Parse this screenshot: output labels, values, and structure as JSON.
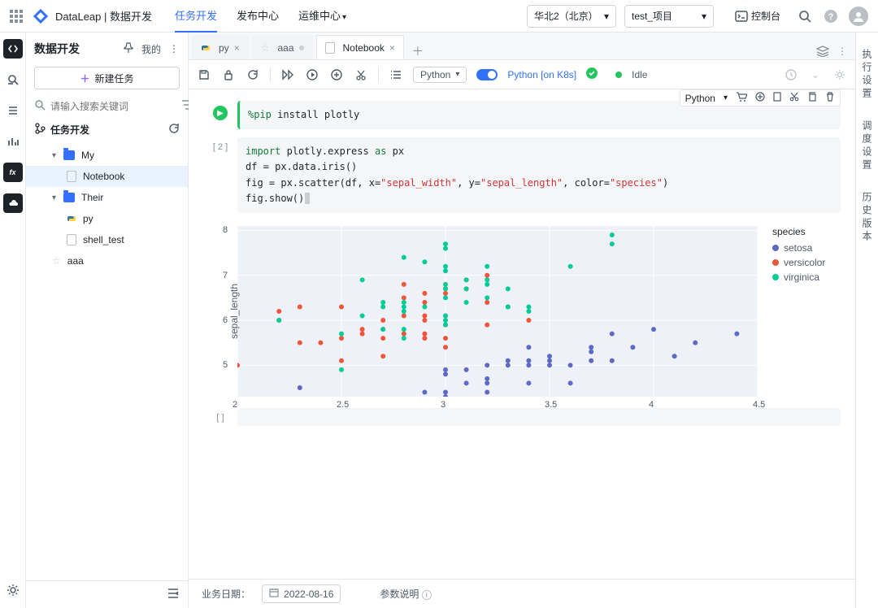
{
  "topbar": {
    "brand": "DataLeap | 数据开发",
    "nav": [
      "任务开发",
      "发布中心",
      "运维中心"
    ],
    "region": "华北2（北京）",
    "project": "test_项目",
    "console": "控制台"
  },
  "sidebar": {
    "title": "数据开发",
    "mine": "我的",
    "new_task": "新建任务",
    "search_placeholder": "请输入搜索关键词",
    "section": "任务开发",
    "tree": {
      "my": "My",
      "notebook": "Notebook",
      "their": "Their",
      "py": "py",
      "shell_test": "shell_test",
      "aaa": "aaa"
    }
  },
  "tabs": {
    "py": "py",
    "aaa": "aaa",
    "notebook": "Notebook"
  },
  "nb_toolbar": {
    "language": "Python",
    "kernel": "Python [on K8s]",
    "idle": "Idle"
  },
  "cell_toolbar": {
    "lang": "Python"
  },
  "cells": {
    "c1_prompt": "",
    "c1_code": "%pip install plotly",
    "c2_prompt": "[ 2 ]",
    "c2_code_plain": "import plotly.express as px\ndf = px.data.iris()\nfig = px.scatter(df, x=\"sepal_width\", y=\"sepal_length\", color=\"species\")\nfig.show()",
    "c3_prompt": "[  ]"
  },
  "chart_data": {
    "type": "scatter",
    "xlabel": "sepal_width",
    "ylabel": "sepal_length",
    "xlim": [
      2,
      4.5
    ],
    "ylim": [
      4.3,
      8.1
    ],
    "xticks": [
      2,
      2.5,
      3,
      3.5,
      4,
      4.5
    ],
    "yticks": [
      5,
      6,
      7,
      8
    ],
    "legend_title": "species",
    "colors": {
      "setosa": "#5c6ac4",
      "versicolor": "#ef553b",
      "virginica": "#00cc96"
    },
    "series": [
      {
        "name": "setosa",
        "points": [
          [
            2.3,
            4.5
          ],
          [
            2.9,
            4.4
          ],
          [
            3.0,
            4.4
          ],
          [
            3.0,
            4.3
          ],
          [
            3.0,
            4.8
          ],
          [
            3.0,
            4.9
          ],
          [
            3.1,
            4.6
          ],
          [
            3.1,
            4.9
          ],
          [
            3.2,
            4.4
          ],
          [
            3.2,
            4.6
          ],
          [
            3.2,
            4.7
          ],
          [
            3.2,
            5.0
          ],
          [
            3.3,
            5.1
          ],
          [
            3.3,
            5.0
          ],
          [
            3.4,
            4.6
          ],
          [
            3.4,
            5.0
          ],
          [
            3.4,
            5.1
          ],
          [
            3.4,
            5.4
          ],
          [
            3.5,
            5.1
          ],
          [
            3.5,
            5.0
          ],
          [
            3.5,
            5.2
          ],
          [
            3.6,
            4.6
          ],
          [
            3.6,
            5.0
          ],
          [
            3.7,
            5.1
          ],
          [
            3.7,
            5.3
          ],
          [
            3.7,
            5.4
          ],
          [
            3.8,
            5.1
          ],
          [
            3.8,
            5.7
          ],
          [
            3.9,
            5.4
          ],
          [
            4.0,
            5.8
          ],
          [
            4.1,
            5.2
          ],
          [
            4.2,
            5.5
          ],
          [
            4.4,
            5.7
          ]
        ]
      },
      {
        "name": "versicolor",
        "points": [
          [
            2.0,
            5.0
          ],
          [
            2.2,
            6.0
          ],
          [
            2.2,
            6.2
          ],
          [
            2.3,
            5.5
          ],
          [
            2.3,
            6.3
          ],
          [
            2.4,
            5.5
          ],
          [
            2.5,
            5.1
          ],
          [
            2.5,
            5.6
          ],
          [
            2.5,
            6.3
          ],
          [
            2.6,
            5.7
          ],
          [
            2.6,
            5.8
          ],
          [
            2.7,
            5.2
          ],
          [
            2.7,
            5.6
          ],
          [
            2.7,
            5.8
          ],
          [
            2.7,
            6.0
          ],
          [
            2.8,
            5.7
          ],
          [
            2.8,
            6.1
          ],
          [
            2.8,
            6.5
          ],
          [
            2.8,
            6.8
          ],
          [
            2.9,
            5.6
          ],
          [
            2.9,
            5.7
          ],
          [
            2.9,
            6.0
          ],
          [
            2.9,
            6.1
          ],
          [
            2.9,
            6.4
          ],
          [
            2.9,
            6.6
          ],
          [
            3.0,
            5.4
          ],
          [
            3.0,
            5.6
          ],
          [
            3.0,
            5.9
          ],
          [
            3.0,
            6.1
          ],
          [
            3.0,
            6.6
          ],
          [
            3.0,
            6.7
          ],
          [
            3.1,
            6.7
          ],
          [
            3.1,
            6.9
          ],
          [
            3.2,
            5.9
          ],
          [
            3.2,
            6.4
          ],
          [
            3.2,
            7.0
          ],
          [
            3.3,
            6.3
          ],
          [
            3.4,
            6.0
          ]
        ]
      },
      {
        "name": "virginica",
        "points": [
          [
            2.2,
            6.0
          ],
          [
            2.5,
            4.9
          ],
          [
            2.5,
            5.7
          ],
          [
            2.6,
            6.1
          ],
          [
            2.6,
            6.9
          ],
          [
            2.7,
            5.8
          ],
          [
            2.7,
            6.3
          ],
          [
            2.7,
            6.4
          ],
          [
            2.8,
            5.6
          ],
          [
            2.8,
            5.8
          ],
          [
            2.8,
            6.2
          ],
          [
            2.8,
            6.3
          ],
          [
            2.8,
            6.4
          ],
          [
            2.8,
            7.4
          ],
          [
            2.9,
            6.3
          ],
          [
            2.9,
            7.3
          ],
          [
            3.0,
            5.9
          ],
          [
            3.0,
            6.0
          ],
          [
            3.0,
            6.1
          ],
          [
            3.0,
            6.5
          ],
          [
            3.0,
            6.7
          ],
          [
            3.0,
            6.8
          ],
          [
            3.0,
            7.1
          ],
          [
            3.0,
            7.2
          ],
          [
            3.0,
            7.6
          ],
          [
            3.0,
            7.7
          ],
          [
            3.1,
            6.4
          ],
          [
            3.1,
            6.7
          ],
          [
            3.1,
            6.9
          ],
          [
            3.2,
            6.5
          ],
          [
            3.2,
            6.8
          ],
          [
            3.2,
            6.9
          ],
          [
            3.2,
            7.2
          ],
          [
            3.3,
            6.3
          ],
          [
            3.3,
            6.7
          ],
          [
            3.4,
            6.2
          ],
          [
            3.4,
            6.3
          ],
          [
            3.6,
            7.2
          ],
          [
            3.8,
            7.7
          ],
          [
            3.8,
            7.9
          ]
        ]
      }
    ]
  },
  "rside": {
    "exec": "执行设置",
    "sched": "调度设置",
    "history": "历史版本"
  },
  "footer": {
    "date_label": "业务日期：",
    "date": "2022-08-16",
    "params": "参数说明"
  }
}
